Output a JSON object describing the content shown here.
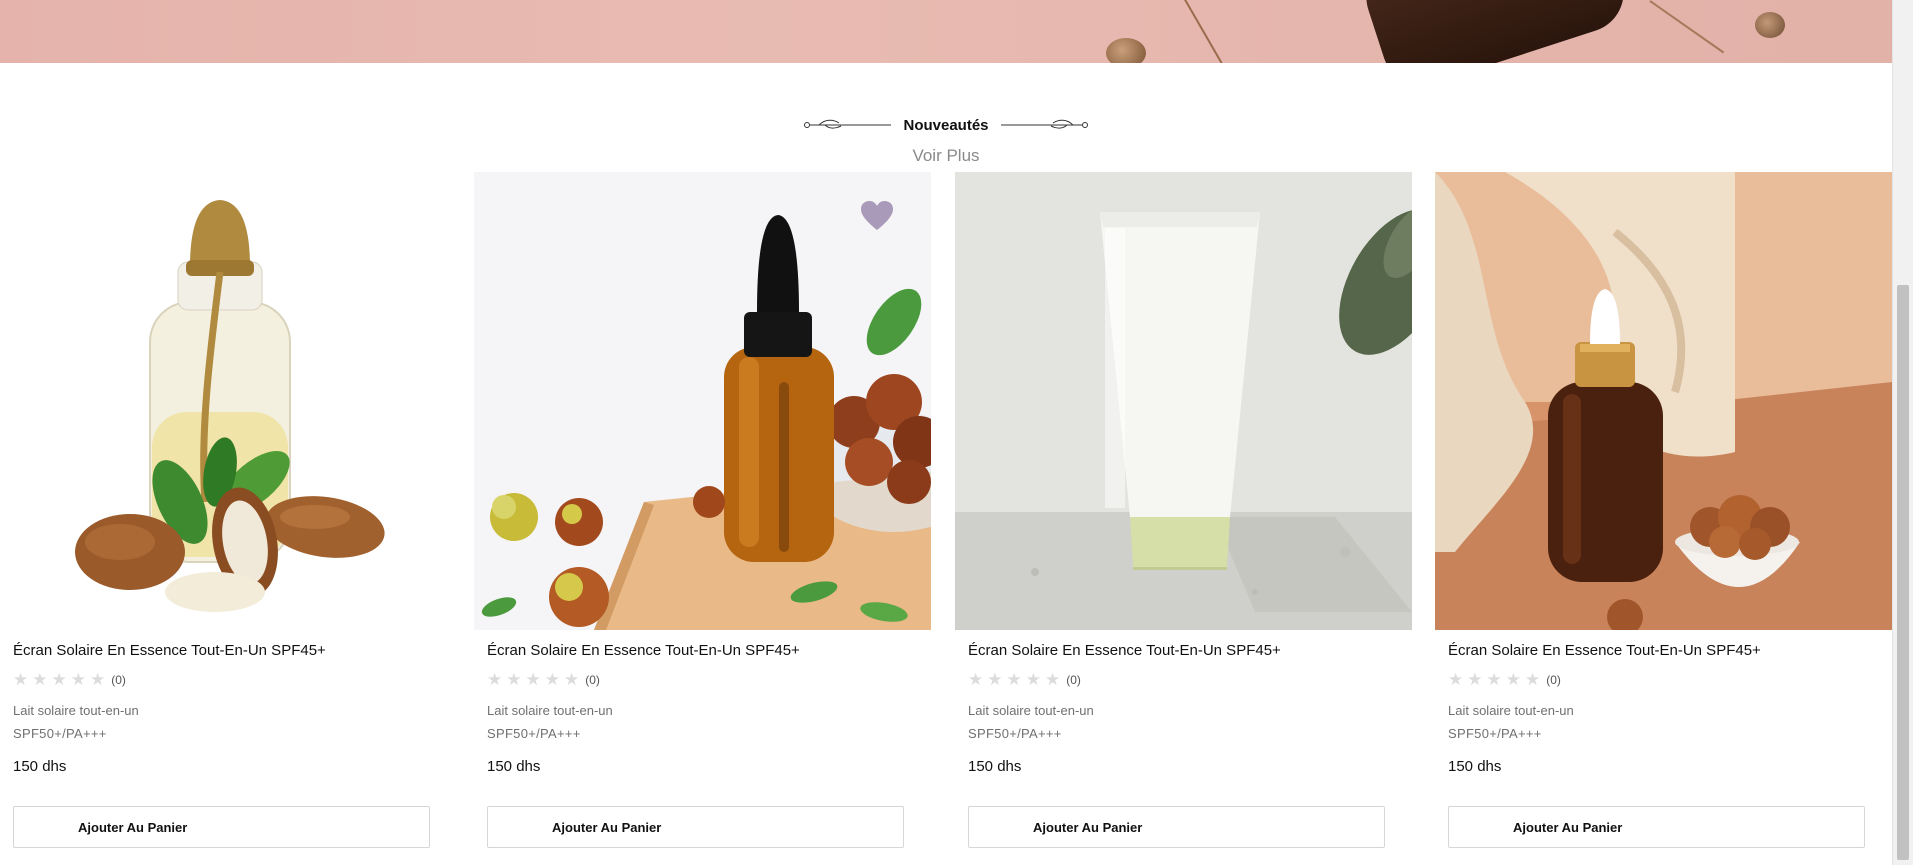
{
  "section": {
    "title": "Nouveautés",
    "see_more": "Voir Plus"
  },
  "products": [
    {
      "name": "Écran Solaire En Essence Tout-En-Un SPF45+",
      "rating_count": "(0)",
      "desc_line1": "Lait solaire tout-en-un",
      "desc_line2": "SPF50+/PA+++",
      "price": "150 dhs",
      "button": "Ajouter Au Panier"
    },
    {
      "name": "Écran Solaire En Essence Tout-En-Un SPF45+",
      "rating_count": "(0)",
      "desc_line1": "Lait solaire tout-en-un",
      "desc_line2": "SPF50+/PA+++",
      "price": "150 dhs",
      "button": "Ajouter Au Panier"
    },
    {
      "name": "Écran Solaire En Essence Tout-En-Un SPF45+",
      "rating_count": "(0)",
      "desc_line1": "Lait solaire tout-en-un",
      "desc_line2": "SPF50+/PA+++",
      "price": "150 dhs",
      "button": "Ajouter Au Panier"
    },
    {
      "name": "Écran Solaire En Essence Tout-En-Un SPF45+",
      "rating_count": "(0)",
      "desc_line1": "Lait solaire tout-en-un",
      "desc_line2": "SPF50+/PA+++",
      "price": "150 dhs",
      "button": "Ajouter Au Panier"
    }
  ],
  "colors": {
    "hero_background": "#e5b3ab",
    "wishlist_heart": "#a89ab8",
    "star_empty": "#dcdcdc"
  },
  "icons": [
    "star-icon",
    "heart-icon",
    "flourish-left-icon",
    "flourish-right-icon"
  ]
}
